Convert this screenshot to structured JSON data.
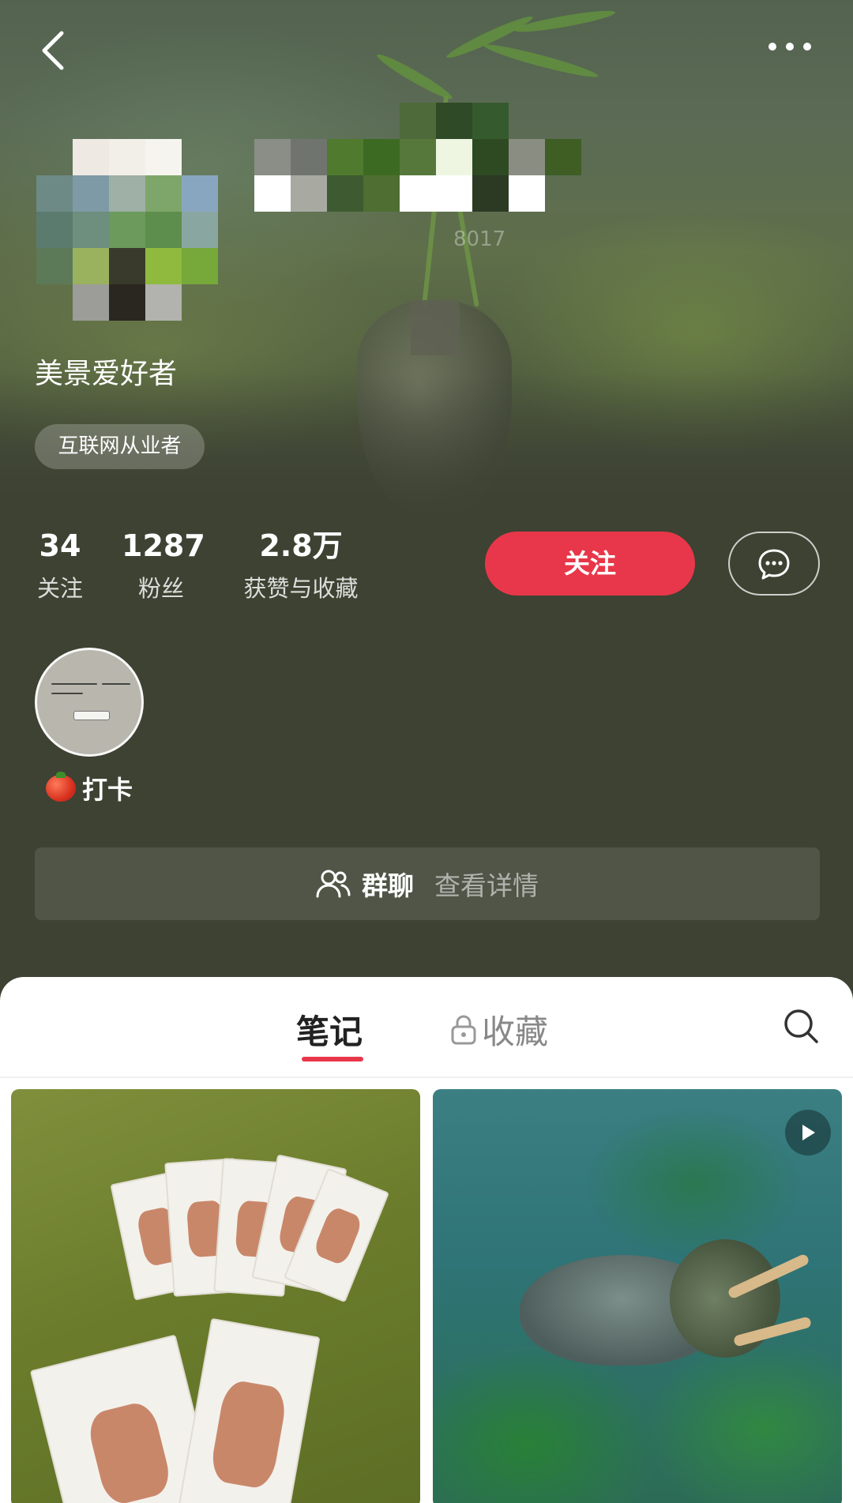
{
  "profile": {
    "id_suffix": "8017",
    "bio_title": "美景爱好者",
    "tag": "互联网从业者"
  },
  "stats": [
    {
      "value": "34",
      "label": "关注"
    },
    {
      "value": "1287",
      "label": "粉丝"
    },
    {
      "value": "2.8万",
      "label": "获赞与收藏"
    }
  ],
  "actions": {
    "follow_label": "关注"
  },
  "highlight": {
    "label": "打卡"
  },
  "group_chat": {
    "title": "群聊",
    "subtitle": "查看详情"
  },
  "tabs": {
    "notes": "笔记",
    "collections": "收藏"
  },
  "icons": [
    "back-icon",
    "more-icon",
    "message-icon",
    "group-icon",
    "lock-icon",
    "search-icon",
    "play-icon"
  ],
  "colors": {
    "accent": "#e8374a",
    "background": "#3d4233"
  }
}
